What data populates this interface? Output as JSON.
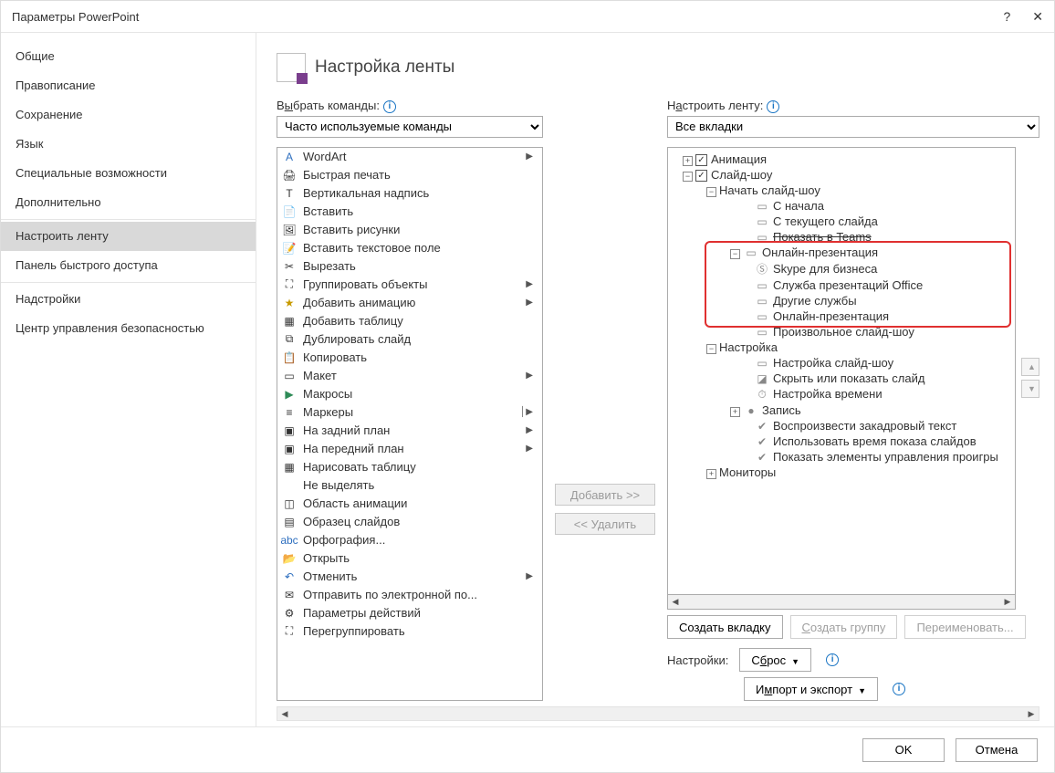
{
  "title": "Параметры PowerPoint",
  "help_glyph": "?",
  "close_glyph": "✕",
  "sidebar": {
    "items": [
      {
        "label": "Общие"
      },
      {
        "label": "Правописание"
      },
      {
        "label": "Сохранение"
      },
      {
        "label": "Язык"
      },
      {
        "label": "Специальные возможности"
      },
      {
        "label": "Дополнительно"
      },
      {
        "label": "Настроить ленту",
        "selected": true
      },
      {
        "label": "Панель быстрого доступа"
      },
      {
        "label": "Надстройки"
      },
      {
        "label": "Центр управления безопасностью"
      }
    ]
  },
  "heading": "Настройка ленты",
  "left": {
    "label_pre": "В",
    "label_under": "ы",
    "label_post": "брать команды:",
    "select": "Часто используемые команды",
    "commands": [
      {
        "icon": "A",
        "label": "WordArt",
        "sub": true,
        "color": "#2e6fbf"
      },
      {
        "icon": "🖨",
        "label": "Быстрая печать"
      },
      {
        "icon": "T",
        "label": "Вертикальная надпись"
      },
      {
        "icon": "📄",
        "label": "Вставить",
        "color": "#c79a00"
      },
      {
        "icon": "🖼",
        "label": "Вставить рисунки"
      },
      {
        "icon": "📝",
        "label": "Вставить текстовое поле"
      },
      {
        "icon": "✂",
        "label": "Вырезать"
      },
      {
        "icon": "⛶",
        "label": "Группировать объекты",
        "sub": true
      },
      {
        "icon": "★",
        "label": "Добавить анимацию",
        "sub": true,
        "color": "#c79a00"
      },
      {
        "icon": "▦",
        "label": "Добавить таблицу"
      },
      {
        "icon": "⧉",
        "label": "Дублировать слайд"
      },
      {
        "icon": "📋",
        "label": "Копировать"
      },
      {
        "icon": "▭",
        "label": "Макет",
        "sub": true
      },
      {
        "icon": "▶",
        "label": "Макросы",
        "color": "#2e8b57"
      },
      {
        "icon": "≡",
        "label": "Маркеры",
        "sub": true,
        "split": true
      },
      {
        "icon": "▣",
        "label": "На задний план",
        "sub": true
      },
      {
        "icon": "▣",
        "label": "На передний план",
        "sub": true
      },
      {
        "icon": "▦",
        "label": "Нарисовать таблицу"
      },
      {
        "icon": "",
        "label": "Не выделять"
      },
      {
        "icon": "◫",
        "label": "Область анимации"
      },
      {
        "icon": "▤",
        "label": "Образец слайдов"
      },
      {
        "icon": "abc",
        "label": "Орфография...",
        "color": "#2e6fbf"
      },
      {
        "icon": "📂",
        "label": "Открыть",
        "color": "#c79a00"
      },
      {
        "icon": "↶",
        "label": "Отменить",
        "sub": true,
        "color": "#2e6fbf"
      },
      {
        "icon": "✉",
        "label": "Отправить по электронной по..."
      },
      {
        "icon": "⚙",
        "label": "Параметры действий"
      },
      {
        "icon": "⛶",
        "label": "Перегруппировать"
      }
    ]
  },
  "mid": {
    "add": "Добавить >>",
    "remove": "<< Удалить"
  },
  "right": {
    "label_pre": "Н",
    "label_under": "а",
    "label_post": "строить ленту:",
    "select": "Все вкладки",
    "buttons": {
      "newtab": "Создать вкладку",
      "newgroup": "Создать группу",
      "rename": "Переименовать..."
    },
    "settings_label": "Настройки:",
    "reset_pre": "С",
    "reset_under": "б",
    "reset_post": "рос",
    "import_pre": "И",
    "import_under": "м",
    "import_post": "порт и экспорт"
  },
  "tree": [
    {
      "d": 1,
      "exp": "+",
      "check": true,
      "label": "Анимация"
    },
    {
      "d": 1,
      "exp": "-",
      "check": true,
      "label": "Слайд-шоу"
    },
    {
      "d": 2,
      "exp": "-",
      "label": "Начать слайд-шоу"
    },
    {
      "d": 4,
      "icon": "▭",
      "label": "С начала"
    },
    {
      "d": 4,
      "icon": "▭",
      "label": "С текущего слайда"
    },
    {
      "d": 4,
      "icon": "▭",
      "label": "Показать в Teams",
      "strike": true
    },
    {
      "d": 3,
      "exp": "-",
      "icon": "▭",
      "label": "Онлайн-презентация",
      "hl": "start"
    },
    {
      "d": 4,
      "icon": "Ⓢ",
      "label": "Skype для бизнеса"
    },
    {
      "d": 4,
      "icon": "▭",
      "label": "Служба презентаций Office"
    },
    {
      "d": 4,
      "icon": "▭",
      "label": "Другие службы"
    },
    {
      "d": 4,
      "icon": "▭",
      "label": "Онлайн-презентация",
      "hl": "end"
    },
    {
      "d": 4,
      "icon": "▭",
      "label": "Произвольное слайд-шоу"
    },
    {
      "d": 2,
      "exp": "-",
      "label": "Настройка"
    },
    {
      "d": 4,
      "icon": "▭",
      "label": "Настройка слайд-шоу"
    },
    {
      "d": 4,
      "icon": "◪",
      "label": "Скрыть или показать слайд"
    },
    {
      "d": 4,
      "icon": "⏱",
      "label": "Настройка времени"
    },
    {
      "d": 3,
      "exp": "+",
      "icon": "●",
      "label": "Запись"
    },
    {
      "d": 4,
      "icon": "✔",
      "label": "Воспроизвести закадровый текст"
    },
    {
      "d": 4,
      "icon": "✔",
      "label": "Использовать время показа слайдов"
    },
    {
      "d": 4,
      "icon": "✔",
      "label": "Показать элементы управления проигры"
    },
    {
      "d": 2,
      "exp": "+",
      "label": "Мониторы"
    }
  ],
  "footer": {
    "ok": "OK",
    "cancel": "Отмена"
  }
}
